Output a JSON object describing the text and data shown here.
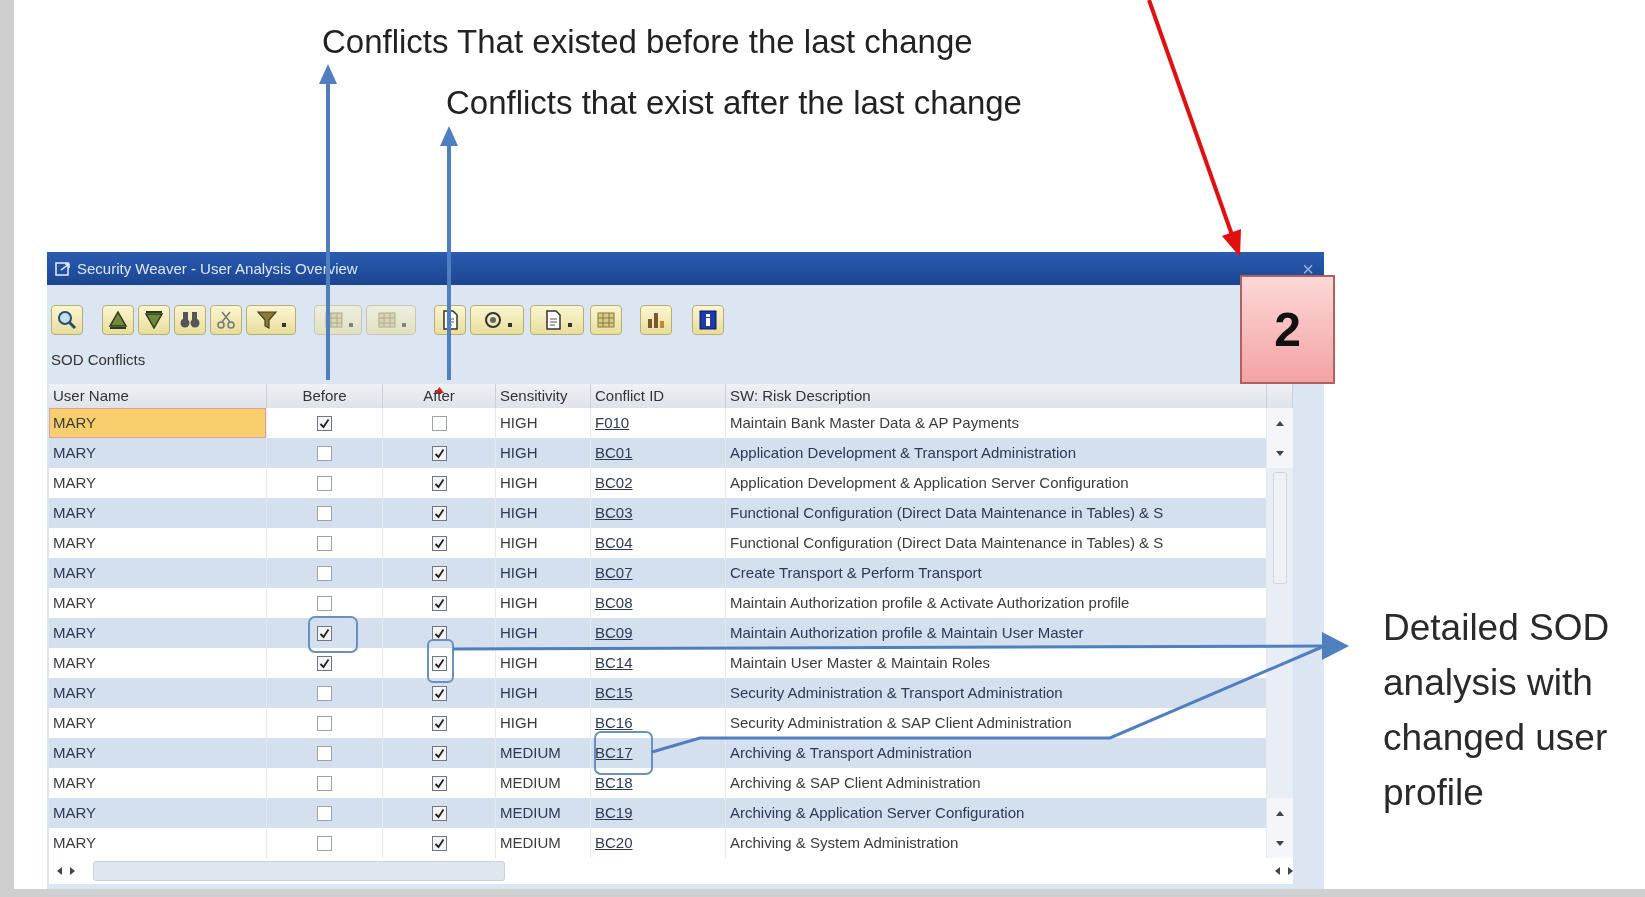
{
  "annotations": {
    "before_note": "Conflicts That existed before the last change",
    "after_note": "Conflicts that exist after the last change",
    "detail_note": "Detailed SOD analysis with changed user profile",
    "step_badge": "2"
  },
  "window": {
    "title": "Security Weaver - User Analysis Overview",
    "close": "×"
  },
  "section_label": "SOD Conflicts",
  "table": {
    "columns": [
      "User Name",
      "Before",
      "After",
      "Sensitivity",
      "Conflict ID",
      "SW: Risk Description"
    ],
    "rows": [
      {
        "user": "MARY",
        "selected": true,
        "before": true,
        "after": false,
        "sensitivity": "HIGH",
        "conflict_id": "F010",
        "description": "Maintain Bank Master Data & AP Payments"
      },
      {
        "user": "MARY",
        "selected": false,
        "before": false,
        "after": true,
        "sensitivity": "HIGH",
        "conflict_id": "BC01",
        "description": "Application Development & Transport Administration"
      },
      {
        "user": "MARY",
        "selected": false,
        "before": false,
        "after": true,
        "sensitivity": "HIGH",
        "conflict_id": "BC02",
        "description": "Application Development & Application Server Configuration"
      },
      {
        "user": "MARY",
        "selected": false,
        "before": false,
        "after": true,
        "sensitivity": "HIGH",
        "conflict_id": "BC03",
        "description": "Functional Configuration (Direct Data Maintenance in Tables) & S"
      },
      {
        "user": "MARY",
        "selected": false,
        "before": false,
        "after": true,
        "sensitivity": "HIGH",
        "conflict_id": "BC04",
        "description": "Functional Configuration (Direct Data Maintenance in Tables) & S"
      },
      {
        "user": "MARY",
        "selected": false,
        "before": false,
        "after": true,
        "sensitivity": "HIGH",
        "conflict_id": "BC07",
        "description": "Create Transport & Perform Transport"
      },
      {
        "user": "MARY",
        "selected": false,
        "before": false,
        "after": true,
        "sensitivity": "HIGH",
        "conflict_id": "BC08",
        "description": "Maintain Authorization profile & Activate Authorization profile"
      },
      {
        "user": "MARY",
        "selected": false,
        "before": true,
        "after": true,
        "sensitivity": "HIGH",
        "conflict_id": "BC09",
        "description": "Maintain Authorization profile & Maintain User Master"
      },
      {
        "user": "MARY",
        "selected": false,
        "before": true,
        "after": true,
        "sensitivity": "HIGH",
        "conflict_id": "BC14",
        "description": "Maintain User Master & Maintain  Roles"
      },
      {
        "user": "MARY",
        "selected": false,
        "before": false,
        "after": true,
        "sensitivity": "HIGH",
        "conflict_id": "BC15",
        "description": "Security Administration & Transport Administration"
      },
      {
        "user": "MARY",
        "selected": false,
        "before": false,
        "after": true,
        "sensitivity": "HIGH",
        "conflict_id": "BC16",
        "description": "Security Administration & SAP Client Administration"
      },
      {
        "user": "MARY",
        "selected": false,
        "before": false,
        "after": true,
        "sensitivity": "MEDIUM",
        "conflict_id": "BC17",
        "description": "Archiving & Transport Administration"
      },
      {
        "user": "MARY",
        "selected": false,
        "before": false,
        "after": true,
        "sensitivity": "MEDIUM",
        "conflict_id": "BC18",
        "description": "Archiving & SAP Client Administration"
      },
      {
        "user": "MARY",
        "selected": false,
        "before": false,
        "after": true,
        "sensitivity": "MEDIUM",
        "conflict_id": "BC19",
        "description": "Archiving & Application Server Configuration"
      },
      {
        "user": "MARY",
        "selected": false,
        "before": false,
        "after": true,
        "sensitivity": "MEDIUM",
        "conflict_id": "BC20",
        "description": "Archiving & System Administration"
      }
    ]
  }
}
